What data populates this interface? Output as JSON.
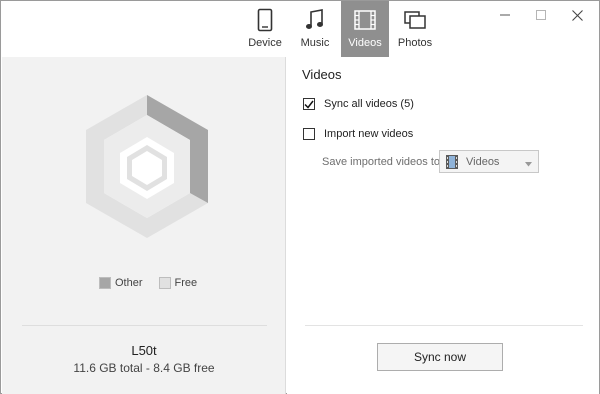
{
  "tabs": [
    {
      "label": "Device",
      "icon": "phone-icon",
      "active": false
    },
    {
      "label": "Music",
      "icon": "music-note-icon",
      "active": false
    },
    {
      "label": "Videos",
      "icon": "film-icon",
      "active": true
    },
    {
      "label": "Photos",
      "icon": "photos-icon",
      "active": false
    }
  ],
  "window_controls": {
    "minimize": "minimize-icon",
    "maximize": "maximize-icon",
    "close": "close-icon"
  },
  "storage": {
    "legend_other": "Other",
    "legend_free": "Free",
    "other_color": "#a6a6a6",
    "free_color": "#e1e1e1",
    "device_name": "L50t",
    "summary": "11.6 GB total - 8.4 GB free"
  },
  "videos": {
    "title": "Videos",
    "sync_all_label": "Sync all videos (5)",
    "sync_all_checked": true,
    "import_label": "Import new videos",
    "import_checked": false,
    "save_label": "Save imported videos to",
    "save_target": "Videos",
    "sync_button": "Sync now"
  }
}
